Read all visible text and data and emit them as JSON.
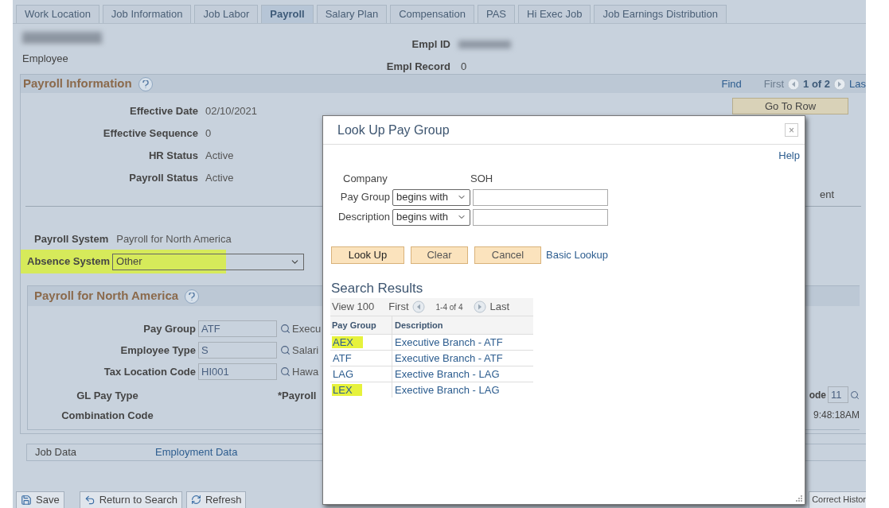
{
  "tabs": [
    {
      "label": "Work Location",
      "selected": false
    },
    {
      "label": "Job Information",
      "selected": false
    },
    {
      "label": "Job Labor",
      "selected": false
    },
    {
      "label": "Payroll",
      "selected": true
    },
    {
      "label": "Salary Plan",
      "selected": false
    },
    {
      "label": "Compensation",
      "selected": false
    },
    {
      "label": "PAS",
      "selected": false
    },
    {
      "label": "Hi Exec Job",
      "selected": false
    },
    {
      "label": "Job Earnings Distribution",
      "selected": false
    }
  ],
  "header": {
    "employee_label": "Employee",
    "empl_id_label": "Empl ID",
    "empl_record_label": "Empl Record",
    "empl_record": "0"
  },
  "payroll_information": {
    "title": "Payroll Information",
    "find": "Find",
    "first": "First",
    "count": "1 of 2",
    "last": "Las",
    "go_to_row": "Go To Row",
    "fields": [
      {
        "label": "Effective Date",
        "value": "02/10/2021"
      },
      {
        "label": "Effective Sequence",
        "value": "0"
      },
      {
        "label": "HR Status",
        "value": "Active"
      },
      {
        "label": "Payroll Status",
        "value": "Active"
      }
    ],
    "cut_text": "ent",
    "payroll_system": {
      "label": "Payroll System",
      "value": "Payroll for North America"
    },
    "absence_system": {
      "label": "Absence System",
      "value": "Other",
      "highlighted": true
    }
  },
  "payroll_for_north_america": {
    "title": "Payroll for North America",
    "fields": [
      {
        "label": "Pay Group",
        "value": "ATF",
        "description": "Execu"
      },
      {
        "label": "Employee Type",
        "value": "S",
        "description": "Salari"
      },
      {
        "label": "Tax Location Code",
        "value": "HI001",
        "description": "Hawa"
      }
    ],
    "gl_pay_type": "GL Pay Type",
    "payroll_label": "*Payroll",
    "code_label": "ode",
    "code_value": "11",
    "combination_code": "Combination Code",
    "time": "9:48:18AM"
  },
  "related": [
    {
      "label": "Job Data",
      "kind": "text"
    },
    {
      "label": "Employment Data",
      "kind": "link"
    }
  ],
  "buttons": [
    {
      "label": "Save",
      "kind": "save"
    },
    {
      "label": "Return to Search",
      "kind": "return"
    },
    {
      "label": "Refresh",
      "kind": "refresh"
    }
  ],
  "right_button": "Correct Histor",
  "dialog": {
    "title": "Look Up Pay Group",
    "close": "×",
    "help": "Help",
    "company_label": "Company",
    "company_value": "SOH",
    "criteria": [
      {
        "label": "Pay Group",
        "operator": "begins with"
      },
      {
        "label": "Description",
        "operator": "begins with"
      }
    ],
    "buttons": [
      {
        "label": "Look Up",
        "kind": "primary"
      },
      {
        "label": "Clear",
        "kind": "normal"
      },
      {
        "label": "Cancel",
        "kind": "normal"
      }
    ],
    "basic_lookup": "Basic Lookup",
    "results_title": "Search Results",
    "nav": {
      "view": "View 100",
      "first": "First",
      "count": "1-4 of 4",
      "last": "Last"
    },
    "columns": [
      "Pay Group",
      "Description"
    ],
    "rows": [
      {
        "pay_group": "AEX",
        "description": "Executive Branch - ATF",
        "highlighted": true
      },
      {
        "pay_group": "ATF",
        "description": "Executive Branch - ATF",
        "highlighted": false
      },
      {
        "pay_group": "LAG",
        "description": "Exective Branch - LAG",
        "highlighted": false
      },
      {
        "pay_group": "LEX",
        "description": "Exective Branch - LAG",
        "highlighted": true
      }
    ]
  }
}
